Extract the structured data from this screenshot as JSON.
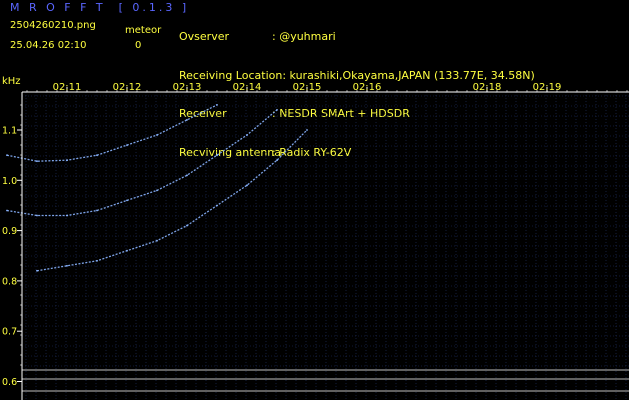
{
  "app": {
    "title": "M R O F F T  [ 0.1.3 ]",
    "filename": "2504260210.png",
    "datetime": "25.04.26 02:10",
    "meteor_label": "meteor",
    "meteor_count": "0"
  },
  "info": {
    "observer_label": "Ovserver",
    "observer_value": ": @yuhmari",
    "location_label": "Receiving Location",
    "location_value": ": kurashiki,Okayama,JAPAN (133.77E, 34.58N)",
    "receiver_label": "Receiver",
    "receiver_value": ": NESDR SMArt + HDSDR",
    "antenna_label": "Recviving antenna",
    "antenna_value": ": Radix RY-62V"
  },
  "colors": {
    "background": "#000000",
    "title": "#5a66ff",
    "text": "#ffff40",
    "axis": "#ffffff",
    "grid": "#223366",
    "trace": "#8ab4ff"
  },
  "chart_data": {
    "type": "scatter",
    "title": "",
    "ylabel": "kHz",
    "xlabel": "",
    "x_ticks": [
      "02:11",
      "02:12",
      "02:13",
      "02:14",
      "02:15",
      "02:16",
      "02:18",
      "02:19"
    ],
    "y_ticks": [
      "1.1",
      "1.0",
      "0.9",
      "0.8",
      "0.7",
      "0.6"
    ],
    "ylim": [
      0.58,
      1.14
    ],
    "grid": true,
    "series": [
      {
        "x": [
          "02:10:00",
          "02:10:30",
          "02:11:00",
          "02:11:30",
          "02:12:00",
          "02:12:30",
          "02:13:00",
          "02:13:30"
        ],
        "values": [
          1.05,
          1.038,
          1.04,
          1.05,
          1.07,
          1.09,
          1.12,
          1.15
        ]
      },
      {
        "x": [
          "02:10:00",
          "02:10:30",
          "02:11:00",
          "02:11:30",
          "02:12:00",
          "02:12:30",
          "02:13:00",
          "02:13:30",
          "02:14:00",
          "02:14:30"
        ],
        "values": [
          0.94,
          0.93,
          0.93,
          0.94,
          0.96,
          0.98,
          1.01,
          1.05,
          1.09,
          1.14
        ]
      },
      {
        "x": [
          "02:10:30",
          "02:11:00",
          "02:11:30",
          "02:12:00",
          "02:12:30",
          "02:13:00",
          "02:13:30",
          "02:14:00",
          "02:14:30",
          "02:15:00"
        ],
        "values": [
          0.82,
          0.83,
          0.84,
          0.86,
          0.88,
          0.91,
          0.95,
          0.99,
          1.04,
          1.1
        ]
      }
    ]
  }
}
